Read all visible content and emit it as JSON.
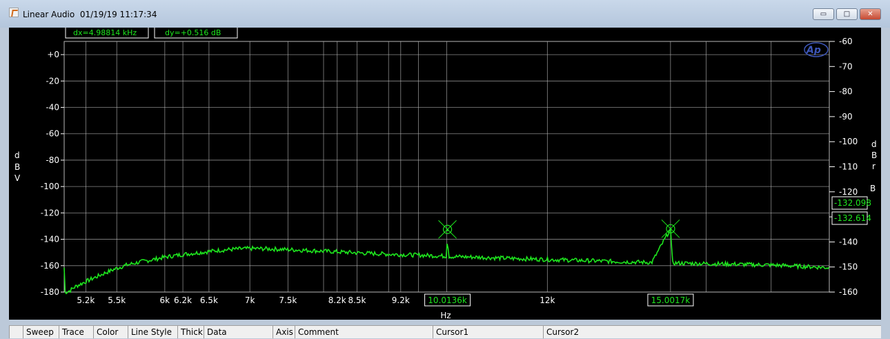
{
  "window": {
    "title": "Linear Audio  01/19/19 11:17:34",
    "minimize_glyph": "▭",
    "maximize_glyph": "□",
    "close_glyph": "✕"
  },
  "readouts": {
    "dx": "dx=4.98814 kHz",
    "dy": "dy=+0.516  dB"
  },
  "logo": "Ap",
  "bottom_bar": {
    "columns": [
      "Sweep",
      "Trace",
      "Color",
      "Line Style",
      "Thick",
      "Data",
      "Axis",
      "Comment",
      "Cursor1",
      "Cursor2"
    ]
  },
  "colors": {
    "trace": "#1ee61e",
    "background": "#000000",
    "grid": "#b8b8b8",
    "text": "#ffffff"
  },
  "chart_data": {
    "type": "line",
    "xlabel": "Hz",
    "ylabel_left": "dBV",
    "ylabel_right": "dBrB",
    "x_scale": "log",
    "xlim": [
      5000,
      20000
    ],
    "ylim_left": [
      -180,
      10
    ],
    "ylim_right": [
      -160,
      -60
    ],
    "x_ticks": [
      {
        "value": 5200,
        "label": "5.2k"
      },
      {
        "value": 5500,
        "label": "5.5k"
      },
      {
        "value": 6000,
        "label": "6k"
      },
      {
        "value": 6200,
        "label": "6.2k"
      },
      {
        "value": 6500,
        "label": "6.5k"
      },
      {
        "value": 7000,
        "label": "7k"
      },
      {
        "value": 7500,
        "label": "7.5k"
      },
      {
        "value": 8200,
        "label": "8.2k"
      },
      {
        "value": 8500,
        "label": "8.5k"
      },
      {
        "value": 9200,
        "label": "9.2k"
      },
      {
        "value": 12000,
        "label": "12k"
      }
    ],
    "x_gridlines": [
      5200,
      5500,
      6000,
      6200,
      6500,
      7000,
      7500,
      8000,
      8200,
      8500,
      9000,
      9200,
      9500,
      10000,
      12000,
      15000,
      16000,
      18000
    ],
    "y_ticks_left": [
      {
        "value": 0,
        "label": "+0"
      },
      {
        "value": -20,
        "label": "-20"
      },
      {
        "value": -40,
        "label": "-40"
      },
      {
        "value": -60,
        "label": "-60"
      },
      {
        "value": -80,
        "label": "-80"
      },
      {
        "value": -100,
        "label": "-100"
      },
      {
        "value": -120,
        "label": "-120"
      },
      {
        "value": -140,
        "label": "-140"
      },
      {
        "value": -160,
        "label": "-160"
      },
      {
        "value": -180,
        "label": "-180"
      }
    ],
    "y_ticks_right": [
      {
        "value": -60,
        "label": "-60"
      },
      {
        "value": -70,
        "label": "-70"
      },
      {
        "value": -80,
        "label": "-80"
      },
      {
        "value": -90,
        "label": "-90"
      },
      {
        "value": -100,
        "label": "-100"
      },
      {
        "value": -110,
        "label": "-110"
      },
      {
        "value": -120,
        "label": "-120"
      },
      {
        "value": -130,
        "label": ""
      },
      {
        "value": -140,
        "label": "-140"
      },
      {
        "value": -150,
        "label": "-150"
      },
      {
        "value": -160,
        "label": "-160"
      }
    ],
    "cursors": [
      {
        "x": 10013.6,
        "x_label": "10.0136k",
        "y_label": "-132.614",
        "y_dBV": -132.5
      },
      {
        "x": 15001.7,
        "x_label": "15.0017k",
        "y_label": "-132.098",
        "y_dBV": -132.0
      }
    ],
    "series": [
      {
        "points": [
          [
            5000,
            -180.5
          ],
          [
            5050,
            -179.0
          ],
          [
            5100,
            -176.0
          ],
          [
            5200,
            -172.0
          ],
          [
            5300,
            -168.5
          ],
          [
            5400,
            -165.0
          ],
          [
            5500,
            -162.0
          ],
          [
            5600,
            -159.5
          ],
          [
            5750,
            -157.0
          ],
          [
            5900,
            -155.0
          ],
          [
            6000,
            -153.5
          ],
          [
            6200,
            -151.5
          ],
          [
            6400,
            -150.0
          ],
          [
            6600,
            -148.5
          ],
          [
            6800,
            -147.5
          ],
          [
            7000,
            -147.0
          ],
          [
            7200,
            -147.2
          ],
          [
            7500,
            -147.8
          ],
          [
            7800,
            -148.5
          ],
          [
            8200,
            -149.5
          ],
          [
            8600,
            -150.5
          ],
          [
            9000,
            -151.3
          ],
          [
            9500,
            -152.0
          ],
          [
            10000,
            -152.8
          ],
          [
            10013.6,
            -132.5
          ],
          [
            10030,
            -153.0
          ],
          [
            10500,
            -153.5
          ],
          [
            11000,
            -154.2
          ],
          [
            11500,
            -154.8
          ],
          [
            12000,
            -155.3
          ],
          [
            12500,
            -155.8
          ],
          [
            13000,
            -156.3
          ],
          [
            13500,
            -156.8
          ],
          [
            14000,
            -157.2
          ],
          [
            14500,
            -157.6
          ],
          [
            15001.7,
            -132.0
          ],
          [
            15050,
            -158.0
          ],
          [
            15500,
            -158.2
          ],
          [
            16000,
            -158.5
          ],
          [
            16500,
            -158.7
          ],
          [
            17000,
            -159.0
          ],
          [
            17500,
            -159.3
          ],
          [
            18000,
            -159.5
          ],
          [
            18500,
            -160.0
          ],
          [
            19000,
            -160.5
          ],
          [
            19500,
            -161.0
          ],
          [
            20000,
            -161.5
          ]
        ]
      }
    ]
  }
}
